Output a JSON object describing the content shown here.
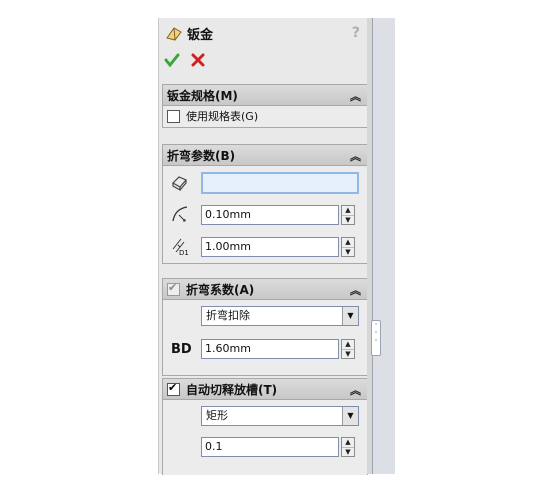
{
  "title": "钣金",
  "help_label": "?",
  "sections": {
    "sheet_metal_gauge": {
      "header": "钣金规格(M)",
      "use_gauge_table_label": "使用规格表(G)"
    },
    "bend_params": {
      "header": "折弯参数(B)",
      "bend_radius_value": "0.10mm",
      "thickness_value": "1.00mm",
      "thickness_icon_label": "D1"
    },
    "bend_allowance": {
      "header": "折弯系数(A)",
      "type_selected": "折弯扣除",
      "bd_label": "BD",
      "bd_value": "1.60mm"
    },
    "auto_relief": {
      "header": "自动切释放槽(T)",
      "type_selected": "矩形",
      "ratio_value": "0.1"
    }
  },
  "icons": {
    "ok": "check-icon",
    "cancel": "x-icon",
    "collapse": "double-chevron-up-icon"
  },
  "colors": {
    "ok_green": "#3aa63a",
    "cancel_red": "#d22020",
    "highlight_input": "#e6f0fb"
  }
}
